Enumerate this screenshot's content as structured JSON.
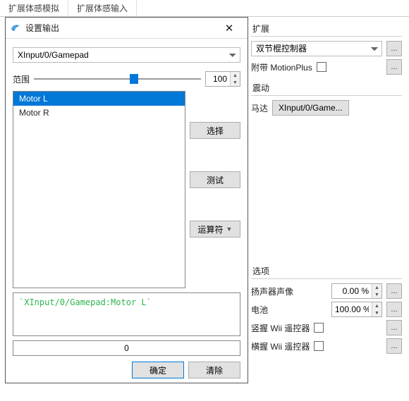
{
  "bg_tabs": {
    "t1": "扩展体感模拟",
    "t2": "扩展体感输入"
  },
  "extension": {
    "title": "扩展",
    "combo_value": "双节棍控制器",
    "motionplus_label": "附带 MotionPlus"
  },
  "rumble": {
    "title": "震动",
    "motor_label": "马达",
    "motor_value": "XInput/0/Game..."
  },
  "options": {
    "title": "选项",
    "speaker_label": "扬声器声像",
    "speaker_value": "0.00 %",
    "battery_label": "电池",
    "battery_value": "100.00 %",
    "vertical_label": "竖握 Wii 遥控器",
    "horizontal_label": "横握 Wii 遥控器"
  },
  "dialog": {
    "title": "设置输出",
    "device_value": "XInput/0/Gamepad",
    "range_label": "范围",
    "range_value": "100",
    "slider_percent": 60,
    "list": {
      "item0": "Motor L",
      "item1": "Motor R"
    },
    "select_btn": "选择",
    "test_btn": "测试",
    "operator_btn": "运算符",
    "expression": "`XInput/0/Gamepad:Motor L`",
    "zero_value": "0",
    "ok_btn": "确定",
    "clear_btn": "清除"
  },
  "glyphs": {
    "dots": "...",
    "close": "✕",
    "up": "▲",
    "down": "▼",
    "caret": "▼"
  }
}
